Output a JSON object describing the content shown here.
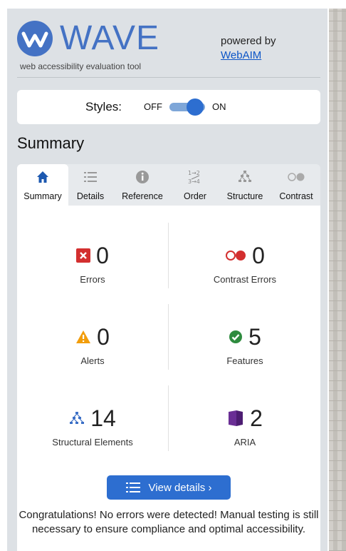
{
  "header": {
    "logo_text": "WAVE",
    "tagline": "web accessibility evaluation tool",
    "powered_by": "powered by",
    "webaim_link": "WebAIM"
  },
  "styles_toggle": {
    "label": "Styles:",
    "off": "OFF",
    "on": "ON",
    "state": "on"
  },
  "section_title": "Summary",
  "tabs": [
    {
      "label": "Summary",
      "icon": "home-icon",
      "active": true
    },
    {
      "label": "Details",
      "icon": "list-icon",
      "active": false
    },
    {
      "label": "Reference",
      "icon": "info-icon",
      "active": false
    },
    {
      "label": "Order",
      "icon": "order-icon",
      "active": false
    },
    {
      "label": "Structure",
      "icon": "structure-icon",
      "active": false
    },
    {
      "label": "Contrast",
      "icon": "contrast-icon",
      "active": false
    }
  ],
  "stats": {
    "errors": {
      "count": "0",
      "label": "Errors",
      "icon": "error-icon"
    },
    "contrast": {
      "count": "0",
      "label": "Contrast Errors",
      "icon": "contrast-error-icon"
    },
    "alerts": {
      "count": "0",
      "label": "Alerts",
      "icon": "alert-icon"
    },
    "features": {
      "count": "5",
      "label": "Features",
      "icon": "feature-icon"
    },
    "structural": {
      "count": "14",
      "label": "Structural Elements",
      "icon": "structure-icon"
    },
    "aria": {
      "count": "2",
      "label": "ARIA",
      "icon": "aria-icon"
    }
  },
  "view_details": "View details ›",
  "message": "Congratulations! No errors were detected! Manual testing is still necessary to ensure compliance and optimal accessibility.",
  "colors": {
    "brand_blue": "#4472c4",
    "button_blue": "#2d6ed0",
    "error_red": "#d32f2f",
    "alert_orange": "#f29d0b",
    "feature_green": "#2e8b3e",
    "aria_purple": "#6a2e95",
    "panel_bg": "#dde1e5"
  }
}
